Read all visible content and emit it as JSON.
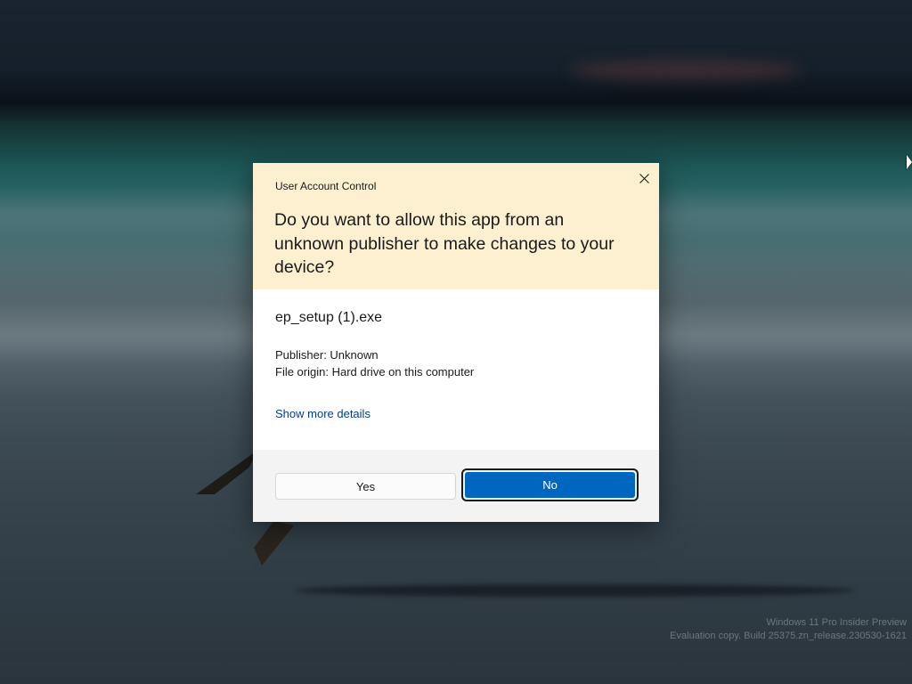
{
  "dialog": {
    "title": "User Account Control",
    "question": "Do you want to allow this app from an unknown publisher to make changes to your device?",
    "app_name": "ep_setup (1).exe",
    "publisher": "Publisher: Unknown",
    "file_origin": "File origin: Hard drive on this computer",
    "details_link": "Show more details",
    "yes_label": "Yes",
    "no_label": "No",
    "close_icon": "close-icon"
  },
  "watermark": {
    "line1": "Windows 11 Pro Insider Preview",
    "line2": "Evaluation copy. Build 25375.zn_release.230530-1621"
  },
  "colors": {
    "header_bg": "#fdf0d0",
    "primary_button": "#0067c0",
    "link": "#003e92",
    "footer_bg": "#f3f3f3"
  }
}
